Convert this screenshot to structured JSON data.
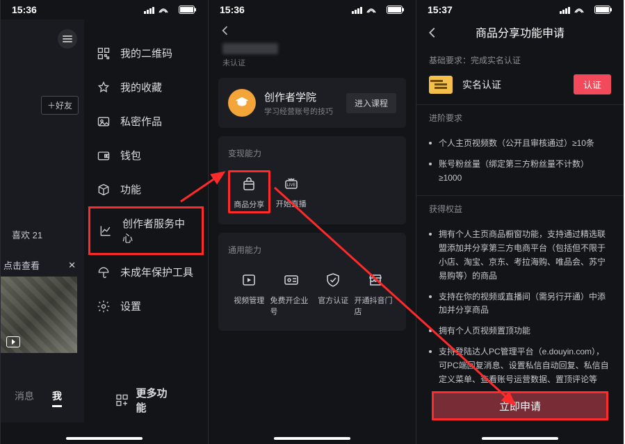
{
  "status": {
    "time1": "15:36",
    "time2": "15:36",
    "time3": "15:37"
  },
  "screen1": {
    "add_friend": "＋好友",
    "likes_label": "喜欢 21",
    "click_view": "点击查看",
    "close_glyph": "✕",
    "tab_msg": "消息",
    "tab_me": "我",
    "drawer": {
      "qr": "我的二维码",
      "fav": "我的收藏",
      "private": "私密作品",
      "wallet": "钱包",
      "function": "功能",
      "creator": "创作者服务中心",
      "minor": "未成年保护工具",
      "settings": "设置",
      "more": "更多功能"
    }
  },
  "screen2": {
    "unverified": "未认证",
    "creator_card": {
      "title": "创作者学院",
      "sub": "学习经营账号的技巧",
      "enter": "进入课程"
    },
    "sec_monetize": "变现能力",
    "sec_general": "通用能力",
    "ab_share": "商品分享",
    "ab_live": "开始直播",
    "ab_video": "视频管理",
    "ab_corp": "免费开企业号",
    "ab_verify": "官方认证",
    "ab_store": "开通抖音门店"
  },
  "screen3": {
    "title": "商品分享功能申请",
    "h_basic": "基础要求：完成实名认证",
    "verify_label": "实名认证",
    "verify_btn": "认证",
    "h_adv": "进阶要求",
    "adv1": "个人主页视频数（公开且审核通过）≥10条",
    "adv2": "账号粉丝量（绑定第三方粉丝量不计数）≥1000",
    "h_rights": "获得权益",
    "r1": "拥有个人主页商品橱窗功能，支持通过精选联盟添加并分享第三方电商平台（包括但不限于小店、淘宝、京东、考拉海购、唯品会、苏宁易购等）的商品",
    "r2": "支持在你的视频或直播间（需另行开通）中添加并分享商品",
    "r3": "拥有个人页视频置顶功能",
    "r4": "支持登陆达人PC管理平台（e.douyin.com），可PC端回复消息、设置私信自动回复、私信自定义菜单、查看账号运营数据、置顶评论等",
    "apply": "立即申请"
  }
}
